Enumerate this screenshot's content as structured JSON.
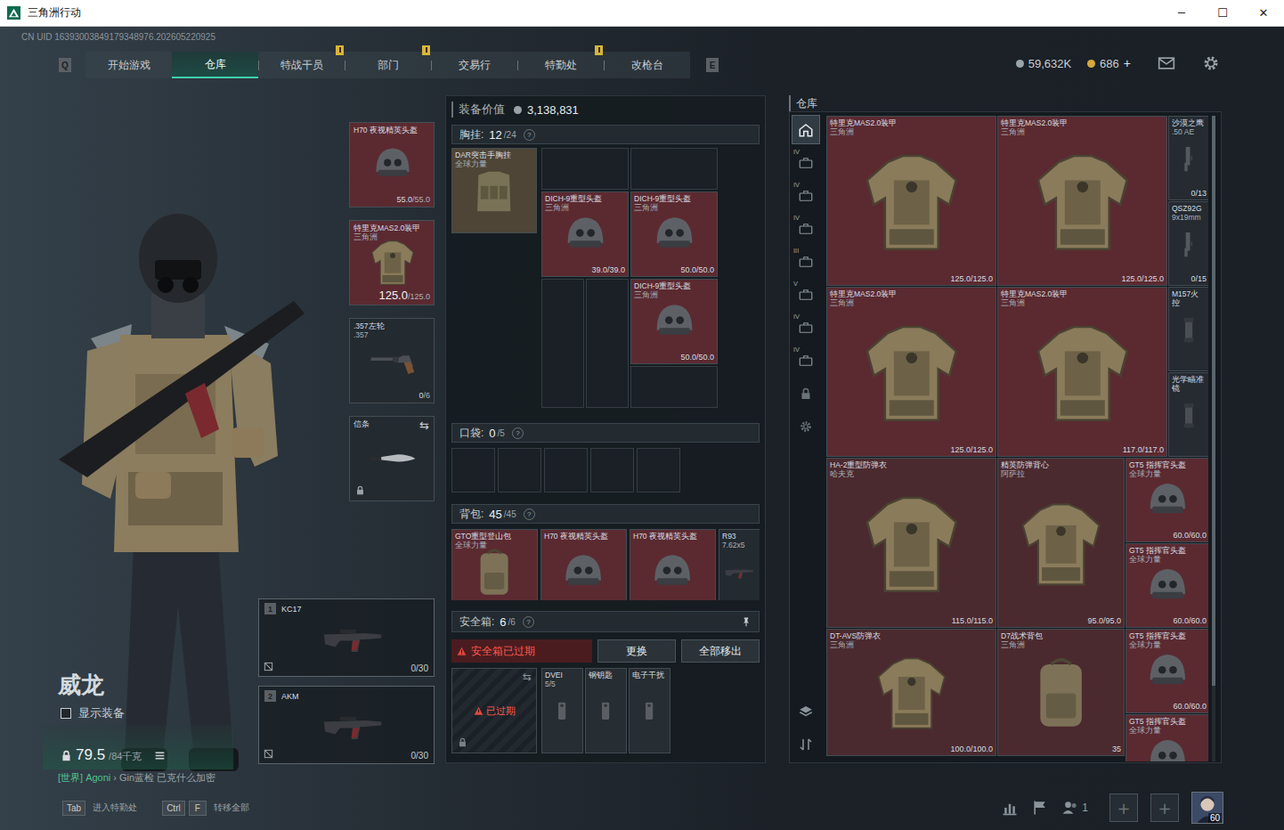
{
  "window": {
    "title": "三角洲行动",
    "controls": [
      "─",
      "☐",
      "✕"
    ]
  },
  "uid": "CN UID 16393003849179348976.202605220925",
  "nav": {
    "left_key": "Q",
    "right_key": "E",
    "tabs": [
      {
        "label": "开始游戏",
        "selected": false,
        "alert": false
      },
      {
        "label": "仓库",
        "selected": true,
        "alert": false
      },
      {
        "label": "特战干员",
        "selected": false,
        "alert": false
      },
      {
        "label": "部门",
        "selected": false,
        "alert": true
      },
      {
        "label": "交易行",
        "selected": false,
        "alert": true
      },
      {
        "label": "特勤处",
        "selected": false,
        "alert": false
      },
      {
        "label": "改枪台",
        "selected": false,
        "alert": true
      }
    ]
  },
  "currencies": [
    {
      "value": "59,632K",
      "color": "#9aa3a8"
    },
    {
      "value": "686",
      "add": "+",
      "color": "#d6a93c"
    }
  ],
  "operator": {
    "name": "威龙",
    "show_gear": {
      "label": "显示装备",
      "checked": false
    },
    "weight": {
      "value": "79.5",
      "max": "/84千克"
    },
    "chat": {
      "channel": "[世界] Agoni",
      "message": "› Gin蓝检 已克什么加密"
    }
  },
  "equipment": [
    {
      "name": "H70 夜视精英头盔",
      "kind": "helmet",
      "value": "55.0",
      "max": "/55.0",
      "color": "#5b2a31",
      "locked": false
    },
    {
      "name": "特里克MAS2.0装甲",
      "sub": "三角洲",
      "kind": "armor",
      "value": "125.0",
      "max": "/125.0",
      "color": "#5b2a31",
      "locked": false
    },
    {
      "name": ".357左轮",
      "sub": ".357",
      "kind": "revolver",
      "value": "0",
      "max": "/6",
      "color": "#232a30",
      "locked": false
    },
    {
      "name": "信条",
      "kind": "knife",
      "swap": "⇆",
      "color": "#232a30",
      "locked": true
    }
  ],
  "weapons": [
    {
      "index": "1",
      "name": "KC17",
      "ammo": "0/30"
    },
    {
      "index": "2",
      "name": "AKM",
      "ammo": "0/30"
    }
  ],
  "loadout": {
    "value_label": "装备价值",
    "value": "3,138,831",
    "chest": {
      "label": "胸挂:",
      "count": "12",
      "capacity": "/24",
      "help": "?",
      "rig": {
        "name": "DAR突击手胸挂",
        "sub": "全球力量",
        "kind": "rig",
        "color": "#4e4536"
      },
      "items": [
        {
          "name": "DICH-9重型头盔",
          "sub": "三角洲",
          "durability": "39.0/39.0",
          "kind": "helmet",
          "color": "#5b2a31"
        },
        {
          "name": "DICH-9重型头盔",
          "sub": "三角洲",
          "durability": "50.0/50.0",
          "kind": "helmet",
          "color": "#5b2a31"
        },
        {
          "name": "DICH-9重型头盔",
          "sub": "三角洲",
          "durability": "50.0/50.0",
          "kind": "helmet",
          "color": "#5b2a31"
        }
      ]
    },
    "pocket": {
      "label": "口袋:",
      "count": "0",
      "capacity": "/5",
      "help": "?",
      "empty_slots": 5
    },
    "backpack": {
      "label": "背包:",
      "count": "45",
      "capacity": "/45",
      "help": "?",
      "items": [
        {
          "name": "GTO重型登山包",
          "sub": "全球力量",
          "kind": "backpack",
          "color": "#5b2a31"
        },
        {
          "name": "H70 夜视精英头盔",
          "kind": "helmet",
          "color": "#5b2a31"
        },
        {
          "name": "H70 夜视精英头盔",
          "kind": "helmet",
          "color": "#5b2a31"
        },
        {
          "name": "R93",
          "sub": "7.62x5",
          "kind": "rifle",
          "color": "#232a30"
        }
      ]
    },
    "safebox": {
      "label": "安全箱:",
      "count": "6",
      "capacity": "/6",
      "help": "?",
      "warning": "安全箱已过期",
      "buttons": [
        "更换",
        "全部移出"
      ],
      "expired_label": "已过期",
      "swap": "⇆",
      "items": [
        {
          "name": "DVEI",
          "sub": "5/5",
          "kind": "key"
        },
        {
          "name": "钢钥匙",
          "kind": "key"
        },
        {
          "name": "电子干扰",
          "kind": "key"
        }
      ]
    }
  },
  "warehouse": {
    "title": "仓库",
    "sidebar": [
      {
        "kind": "home",
        "selected": true
      },
      {
        "kind": "case",
        "tag": "IV",
        "selected": false
      },
      {
        "kind": "case",
        "tag": "IV",
        "selected": false
      },
      {
        "kind": "case",
        "tag": "IV",
        "selected": false
      },
      {
        "kind": "case",
        "tag": "III",
        "selected": false
      },
      {
        "kind": "case",
        "tag": "V",
        "selected": false
      },
      {
        "kind": "case",
        "tag": "IV",
        "selected": false
      },
      {
        "kind": "case",
        "tag": "IV",
        "selected": false
      },
      {
        "kind": "lock",
        "selected": false
      },
      {
        "kind": "gear",
        "selected": false
      }
    ],
    "tools": [
      {
        "kind": "layers"
      },
      {
        "kind": "sort"
      }
    ],
    "items": [
      {
        "name": "特里克MAS2.0装甲",
        "sub": "三角洲",
        "durability": "125.0/125.0",
        "kind": "armor",
        "color": "#5b2a31"
      },
      {
        "name": "特里克MAS2.0装甲",
        "sub": "三角洲",
        "durability": "125.0/125.0",
        "kind": "armor",
        "color": "#5b2a31"
      },
      {
        "name": "沙漠之鹰",
        "sub": ".50 AE",
        "durability": "0/13",
        "kind": "pistol",
        "color": "#252b31"
      },
      {
        "name": "QSZ92G",
        "sub": "9x19mm",
        "durability": "0/15",
        "kind": "pistol",
        "color": "#252b31"
      },
      {
        "name": "特里克MAS2.0装甲",
        "sub": "三角洲",
        "durability": "125.0/125.0",
        "kind": "armor",
        "color": "#5b2a31"
      },
      {
        "name": "特里克MAS2.0装甲",
        "sub": "三角洲",
        "durability": "117.0/117.0",
        "kind": "armor",
        "color": "#5b2a31"
      },
      {
        "name": "M157火控",
        "kind": "scope",
        "color": "#252b31"
      },
      {
        "name": "光学瞄准镜",
        "kind": "scope",
        "color": "#252b31"
      },
      {
        "name": "HA-2重型防弹衣",
        "sub": "哈夫克",
        "durability": "115.0/115.0",
        "kind": "armor",
        "color": "#4b2a2f"
      },
      {
        "name": "精英防弹背心",
        "sub": "阿萨拉",
        "durability": "95.0/95.0",
        "kind": "armor",
        "color": "#4b2a2f"
      },
      {
        "name": "GT5 指挥官头盔",
        "sub": "全球力量",
        "durability": "60.0/60.0",
        "kind": "helmet",
        "color": "#5b2a31"
      },
      {
        "name": "GT5 指挥官头盔",
        "sub": "全球力量",
        "durability": "60.0/60.0",
        "kind": "helmet",
        "color": "#5b2a31"
      },
      {
        "name": "DT-AVS防弹衣",
        "sub": "三角洲",
        "durability": "100.0/100.0",
        "kind": "armor",
        "color": "#4b2a2f"
      },
      {
        "name": "D7战术背包",
        "sub": "三角洲",
        "durability": "35",
        "kind": "backpack",
        "color": "#4b2a2f"
      },
      {
        "name": "GT5 指挥官头盔",
        "sub": "全球力量",
        "durability": "60.0/60.0",
        "kind": "helmet",
        "color": "#5b2a31"
      },
      {
        "name": "GT5 指挥官头盔",
        "sub": "全球力量",
        "kind": "helmet",
        "color": "#5b2a31"
      }
    ]
  },
  "footer": {
    "hints": [
      {
        "keys": [
          "Tab"
        ],
        "label": "进入特勤处"
      },
      {
        "keys": [
          "Ctrl",
          "F"
        ],
        "label": "转移全部"
      }
    ],
    "friends": "1",
    "add_buttons": [
      "+",
      "+"
    ],
    "level": "60"
  }
}
